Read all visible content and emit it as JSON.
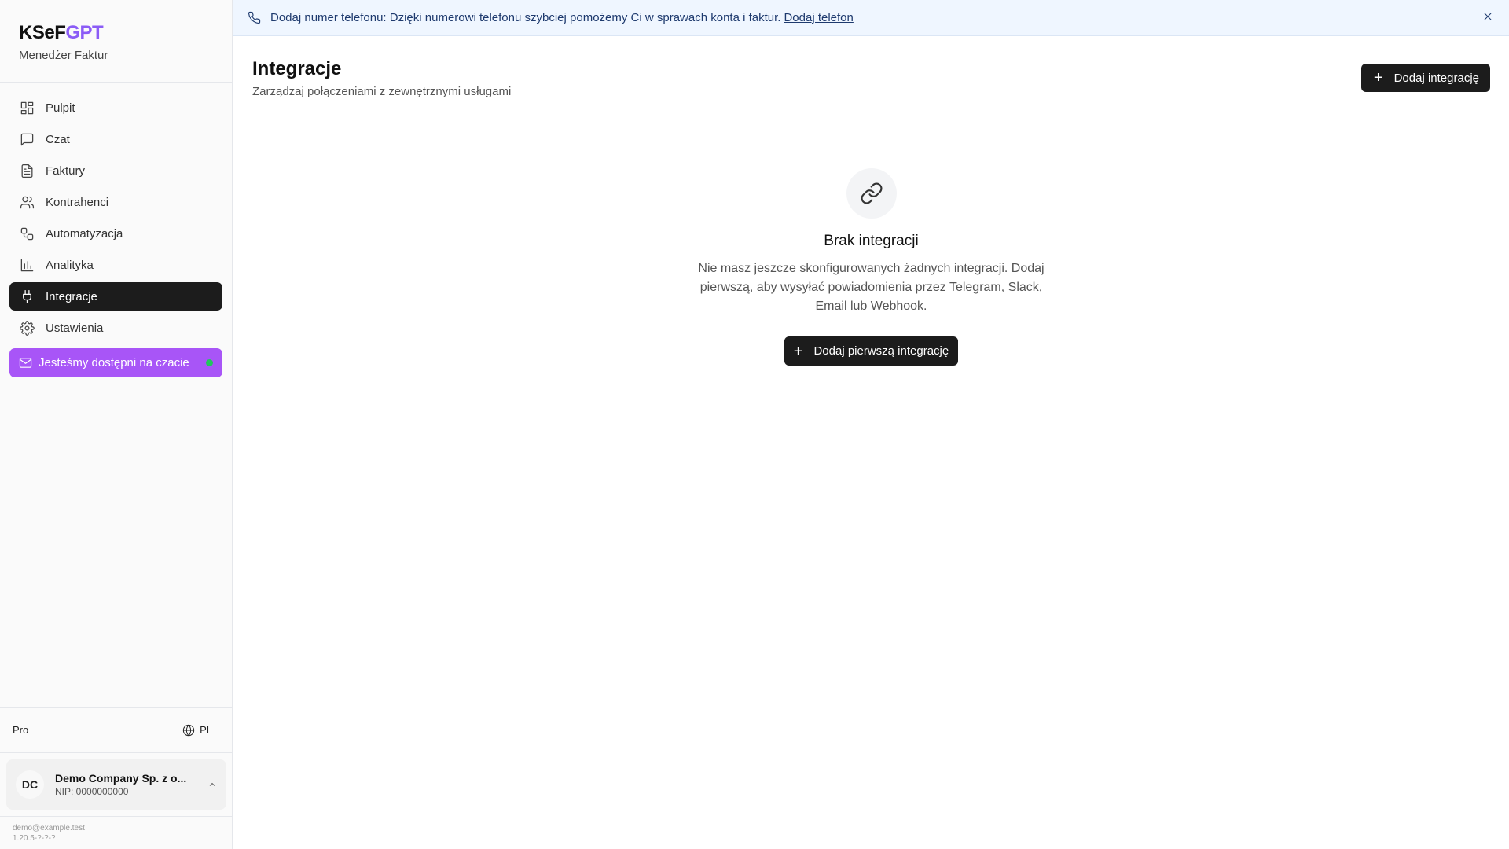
{
  "brand": {
    "title_main": "KSeF",
    "title_accent": "GPT",
    "subtitle": "Menedżer Faktur"
  },
  "nav": {
    "items": [
      {
        "label": "Pulpit",
        "icon": "dashboard-icon"
      },
      {
        "label": "Czat",
        "icon": "chat-icon"
      },
      {
        "label": "Faktury",
        "icon": "invoice-icon"
      },
      {
        "label": "Kontrahenci",
        "icon": "users-icon"
      },
      {
        "label": "Automatyzacja",
        "icon": "workflow-icon"
      },
      {
        "label": "Analityka",
        "icon": "bar-chart-icon"
      },
      {
        "label": "Integracje",
        "icon": "plug-icon",
        "active": true
      },
      {
        "label": "Ustawienia",
        "icon": "gear-icon"
      }
    ],
    "chat_pill": "Jesteśmy dostępni na czacie"
  },
  "sidebar_bottom": {
    "plan": "Pro",
    "language": "PL",
    "company": {
      "initials": "DC",
      "name": "Demo Company Sp. z o...",
      "nip": "NIP: 0000000000"
    },
    "email": "demo@example.test",
    "version": "1.20.5-?-?-?"
  },
  "banner": {
    "text": "Dodaj numer telefonu: Dzięki numerowi telefonu szybciej pomożemy Ci w sprawach konta i faktur.",
    "link": "Dodaj telefon"
  },
  "page": {
    "title": "Integracje",
    "subtitle": "Zarządzaj połączeniami z zewnętrznymi usługami",
    "add_button": "Dodaj integrację"
  },
  "empty_state": {
    "title": "Brak integracji",
    "description": "Nie masz jeszcze skonfigurowanych żadnych integracji. Dodaj pierwszą, aby wysyłać powiadomienia przez Telegram, Slack, Email lub Webhook.",
    "button": "Dodaj pierwszą integrację"
  },
  "colors": {
    "accent": "#8b5cf6",
    "chat_pill": "#a855f7",
    "online": "#22c55e",
    "dark": "#1c1c1c",
    "banner_bg": "#eff6ff"
  }
}
